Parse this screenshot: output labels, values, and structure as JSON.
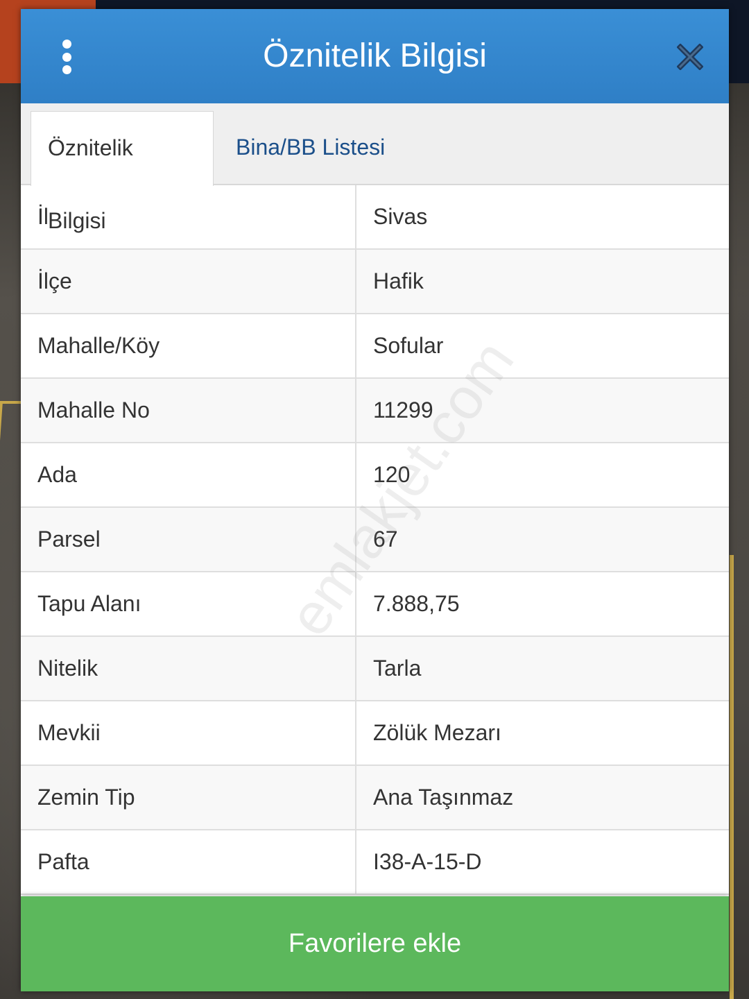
{
  "dialog": {
    "title": "Öznitelik Bilgisi",
    "tabs": [
      {
        "label": "Öznitelik Bilgisi",
        "active": true
      },
      {
        "label": "Bina/BB Listesi",
        "active": false
      }
    ],
    "rows": [
      {
        "label": "İl",
        "value": "Sivas"
      },
      {
        "label": "İlçe",
        "value": "Hafik"
      },
      {
        "label": "Mahalle/Köy",
        "value": "Sofular"
      },
      {
        "label": "Mahalle No",
        "value": "11299"
      },
      {
        "label": "Ada",
        "value": "120"
      },
      {
        "label": "Parsel",
        "value": "67"
      },
      {
        "label": "Tapu Alanı",
        "value": "7.888,75"
      },
      {
        "label": "Nitelik",
        "value": "Tarla"
      },
      {
        "label": "Mevkii",
        "value": "Zölük Mezarı"
      },
      {
        "label": "Zemin Tip",
        "value": "Ana Taşınmaz"
      },
      {
        "label": "Pafta",
        "value": "I38-A-15-D"
      }
    ],
    "favorite_button_label": "Favorilere ekle"
  },
  "watermark": "emlakjet.com",
  "colors": {
    "header": "#2f7fc6",
    "tab_inactive_text": "#1b4f8a",
    "favorite_button": "#5cb85c"
  },
  "icons": {
    "menu": "kebab-menu-icon",
    "close": "close-icon"
  }
}
